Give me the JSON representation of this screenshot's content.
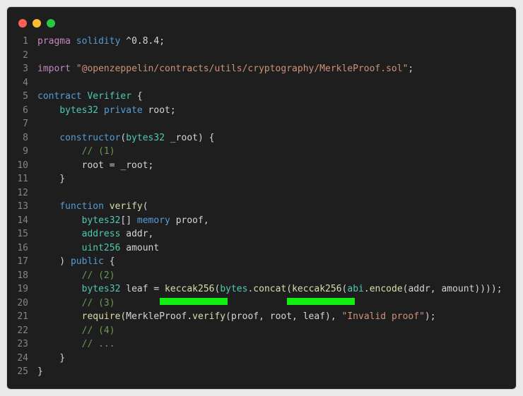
{
  "window": {
    "traffic_lights": [
      {
        "name": "close",
        "color": "#ff5f57"
      },
      {
        "name": "minimize",
        "color": "#febc2e"
      },
      {
        "name": "zoom",
        "color": "#28c840"
      }
    ]
  },
  "token_colors": {
    "kw": "#c586c0",
    "kw2": "#569cd6",
    "type": "#4ec9b0",
    "fn": "#dcdcaa",
    "str": "#ce9178",
    "com": "#6a9955",
    "txt": "#d4d4d4"
  },
  "highlight_color": "#12f012",
  "code_lines": [
    {
      "n": "1",
      "tokens": [
        [
          "kw",
          "pragma"
        ],
        [
          "txt",
          " "
        ],
        [
          "kw2",
          "solidity"
        ],
        [
          "txt",
          " ^0.8.4;"
        ]
      ]
    },
    {
      "n": "2",
      "tokens": []
    },
    {
      "n": "3",
      "tokens": [
        [
          "kw",
          "import"
        ],
        [
          "txt",
          " "
        ],
        [
          "str",
          "\"@openzeppelin/contracts/utils/cryptography/MerkleProof.sol\""
        ],
        [
          "txt",
          ";"
        ]
      ]
    },
    {
      "n": "4",
      "tokens": []
    },
    {
      "n": "5",
      "tokens": [
        [
          "kw2",
          "contract"
        ],
        [
          "txt",
          " "
        ],
        [
          "type",
          "Verifier"
        ],
        [
          "txt",
          " {"
        ]
      ]
    },
    {
      "n": "6",
      "tokens": [
        [
          "txt",
          "    "
        ],
        [
          "type",
          "bytes32"
        ],
        [
          "txt",
          " "
        ],
        [
          "kw2",
          "private"
        ],
        [
          "txt",
          " root;"
        ]
      ]
    },
    {
      "n": "7",
      "tokens": []
    },
    {
      "n": "8",
      "tokens": [
        [
          "txt",
          "    "
        ],
        [
          "kw2",
          "constructor"
        ],
        [
          "txt",
          "("
        ],
        [
          "type",
          "bytes32"
        ],
        [
          "txt",
          " _root) {"
        ]
      ]
    },
    {
      "n": "9",
      "tokens": [
        [
          "txt",
          "        "
        ],
        [
          "com",
          "// (1)"
        ]
      ]
    },
    {
      "n": "10",
      "tokens": [
        [
          "txt",
          "        root = _root;"
        ]
      ]
    },
    {
      "n": "11",
      "tokens": [
        [
          "txt",
          "    }"
        ]
      ]
    },
    {
      "n": "12",
      "tokens": []
    },
    {
      "n": "13",
      "tokens": [
        [
          "txt",
          "    "
        ],
        [
          "kw2",
          "function"
        ],
        [
          "txt",
          " "
        ],
        [
          "fn",
          "verify"
        ],
        [
          "txt",
          "("
        ]
      ]
    },
    {
      "n": "14",
      "tokens": [
        [
          "txt",
          "        "
        ],
        [
          "type",
          "bytes32"
        ],
        [
          "txt",
          "[] "
        ],
        [
          "kw2",
          "memory"
        ],
        [
          "txt",
          " proof,"
        ]
      ]
    },
    {
      "n": "15",
      "tokens": [
        [
          "txt",
          "        "
        ],
        [
          "type",
          "address"
        ],
        [
          "txt",
          " addr,"
        ]
      ]
    },
    {
      "n": "16",
      "tokens": [
        [
          "txt",
          "        "
        ],
        [
          "type",
          "uint256"
        ],
        [
          "txt",
          " amount"
        ]
      ]
    },
    {
      "n": "17",
      "tokens": [
        [
          "txt",
          "    ) "
        ],
        [
          "kw2",
          "public"
        ],
        [
          "txt",
          " {"
        ]
      ]
    },
    {
      "n": "18",
      "tokens": [
        [
          "txt",
          "        "
        ],
        [
          "com",
          "// (2)"
        ]
      ]
    },
    {
      "n": "19",
      "tokens": [
        [
          "txt",
          "        "
        ],
        [
          "type",
          "bytes32"
        ],
        [
          "txt",
          " leaf = "
        ],
        [
          "fn",
          "keccak256"
        ],
        [
          "txt",
          "("
        ],
        [
          "type",
          "bytes"
        ],
        [
          "txt",
          "."
        ],
        [
          "fn",
          "concat"
        ],
        [
          "txt",
          "("
        ],
        [
          "fn",
          "keccak256"
        ],
        [
          "txt",
          "("
        ],
        [
          "type",
          "abi"
        ],
        [
          "txt",
          "."
        ],
        [
          "fn",
          "encode"
        ],
        [
          "txt",
          "(addr, amount))));"
        ]
      ]
    },
    {
      "n": "20",
      "tokens": [
        [
          "txt",
          "        "
        ],
        [
          "com",
          "// (3)"
        ]
      ]
    },
    {
      "n": "21",
      "tokens": [
        [
          "txt",
          "        "
        ],
        [
          "fn",
          "require"
        ],
        [
          "txt",
          "(MerkleProof."
        ],
        [
          "fn",
          "verify"
        ],
        [
          "txt",
          "(proof, root, leaf), "
        ],
        [
          "str",
          "\"Invalid proof\""
        ],
        [
          "txt",
          ");"
        ]
      ]
    },
    {
      "n": "22",
      "tokens": [
        [
          "txt",
          "        "
        ],
        [
          "com",
          "// (4)"
        ]
      ]
    },
    {
      "n": "23",
      "tokens": [
        [
          "txt",
          "        "
        ],
        [
          "com",
          "// ..."
        ]
      ]
    },
    {
      "n": "24",
      "tokens": [
        [
          "txt",
          "    }"
        ]
      ]
    },
    {
      "n": "25",
      "tokens": [
        [
          "txt",
          "}"
        ]
      ]
    }
  ]
}
